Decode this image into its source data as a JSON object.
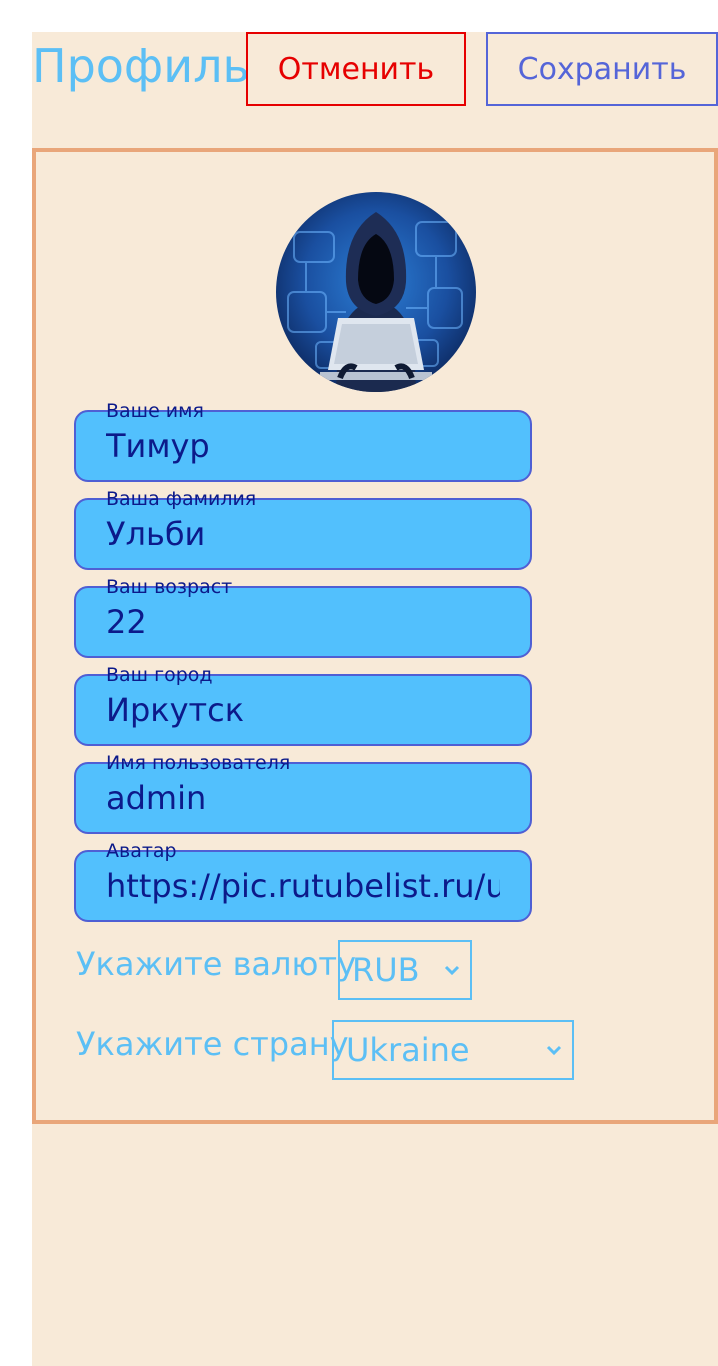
{
  "header": {
    "title": "Профиль",
    "cancel_label": "Отменить",
    "save_label": "Сохранить"
  },
  "profile": {
    "avatar_icon": "hacker-avatar-image",
    "fields": [
      {
        "label": "Ваше имя",
        "value": "Тимур"
      },
      {
        "label": "Ваша фамилия",
        "value": "Ульби"
      },
      {
        "label": "Ваш возраст",
        "value": "22"
      },
      {
        "label": "Ваш город",
        "value": "Иркутск"
      },
      {
        "label": "Имя пользователя",
        "value": "admin"
      },
      {
        "label": "Аватар",
        "value": "https://pic.rutubelist.ru/us"
      }
    ],
    "currency": {
      "label": "Укажите валюту",
      "selected": "RUB"
    },
    "country": {
      "label": "Укажите страну",
      "selected": "Ukraine"
    }
  },
  "colors": {
    "page_background": "#f8ead8",
    "accent_blue": "#5cbff5",
    "field_fill": "#52c0fd",
    "field_text": "#0c1a8a",
    "cancel": "#e60000",
    "save": "#5565d8",
    "card_border": "#e9a67a"
  }
}
